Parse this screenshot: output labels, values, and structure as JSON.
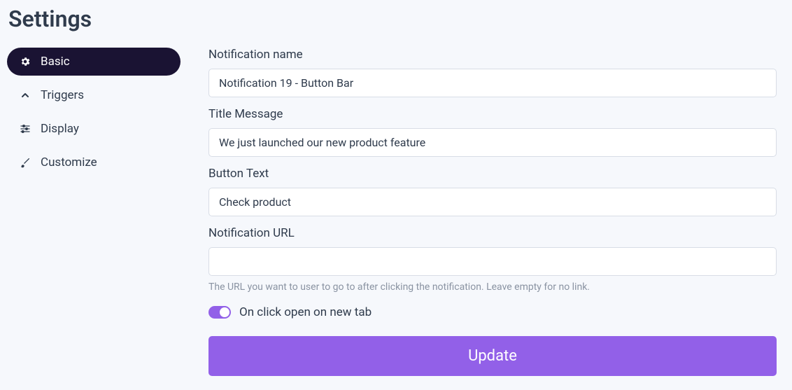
{
  "page_title": "Settings",
  "sidebar": {
    "items": [
      {
        "label": "Basic",
        "icon": "gear-icon",
        "active": true
      },
      {
        "label": "Triggers",
        "icon": "chevron-up-icon",
        "active": false
      },
      {
        "label": "Display",
        "icon": "sliders-icon",
        "active": false
      },
      {
        "label": "Customize",
        "icon": "brush-icon",
        "active": false
      }
    ]
  },
  "form": {
    "notification_name": {
      "label": "Notification name",
      "value": "Notification 19 - Button Bar"
    },
    "title_message": {
      "label": "Title Message",
      "value": "We just launched our new product feature"
    },
    "button_text": {
      "label": "Button Text",
      "value": "Check product"
    },
    "notification_url": {
      "label": "Notification URL",
      "value": "",
      "help": "The URL you want to user to go to after clicking the notification. Leave empty for no link."
    },
    "new_tab_toggle": {
      "label": "On click open on new tab",
      "checked": true
    },
    "submit_label": "Update"
  },
  "colors": {
    "accent": "#9260e8",
    "sidebar_active": "#1a1333"
  }
}
